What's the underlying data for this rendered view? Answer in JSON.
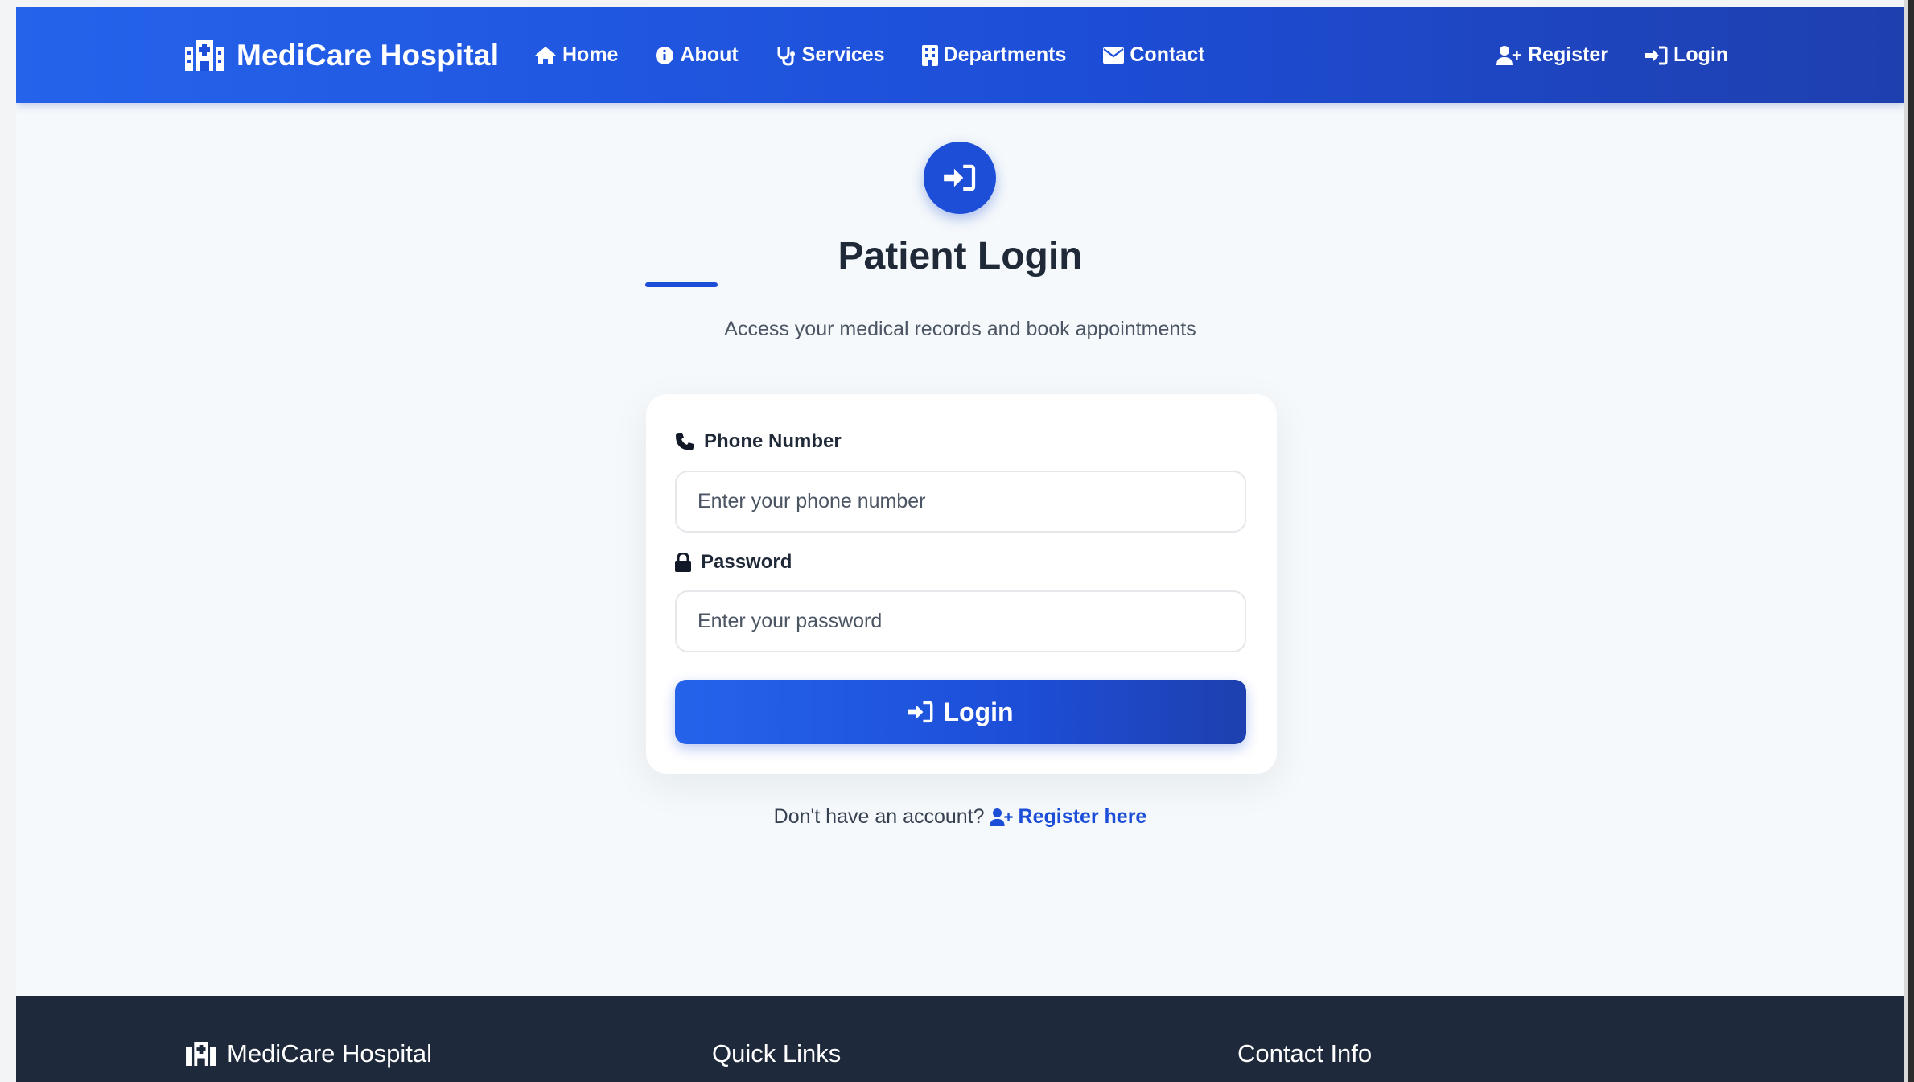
{
  "navbar": {
    "brand": "MediCare Hospital",
    "links": [
      {
        "label": "Home",
        "icon": "home-icon"
      },
      {
        "label": "About",
        "icon": "info-icon"
      },
      {
        "label": "Services",
        "icon": "stethoscope-icon"
      },
      {
        "label": "Departments",
        "icon": "building-icon"
      },
      {
        "label": "Contact",
        "icon": "envelope-icon"
      }
    ],
    "right": [
      {
        "label": "Register",
        "icon": "user-plus-icon"
      },
      {
        "label": "Login",
        "icon": "sign-in-icon"
      }
    ]
  },
  "main": {
    "title": "Patient Login",
    "subtitle": "Access your medical records and book appointments",
    "phone": {
      "label": "Phone Number",
      "placeholder": "Enter your phone number",
      "value": ""
    },
    "password": {
      "label": "Password",
      "placeholder": "Enter your password",
      "value": ""
    },
    "login_button": "Login",
    "register_prompt": "Don't have an account?",
    "register_link": "Register here"
  },
  "footer": {
    "brand": "MediCare Hospital",
    "quick_links": "Quick Links",
    "contact_info": "Contact Info"
  },
  "colors": {
    "primary": "#1d4ed8",
    "primary_light": "#2563eb",
    "footer_bg": "#1e293b",
    "page_bg": "#f5f9fb",
    "title_text": "#1f2937"
  }
}
